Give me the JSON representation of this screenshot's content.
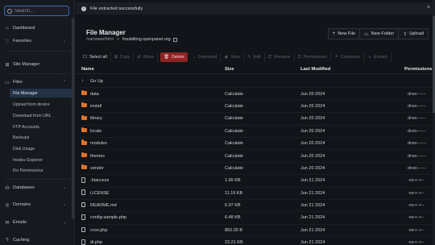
{
  "sidebar": {
    "search_placeholder": "Search...",
    "dashboard": "Dashboard",
    "favorites": "Favorites",
    "site_manager": "Site Manager",
    "files": "Files",
    "files_sub": [
      "File Manager",
      "Upload from device",
      "Download from URL",
      "FTP Accounts",
      "Backups",
      "Disk Usage",
      "Inodes Explorer",
      "Fix Permissions"
    ],
    "databases": "Databases",
    "domains": "Domains",
    "emails": "Emails",
    "caching": "Caching"
  },
  "toast": {
    "message": "File extracted successfully",
    "info_glyph": "i",
    "close_glyph": "×"
  },
  "page": {
    "title": "File Manager",
    "path_root": "/var/www/html",
    "path_sep": ">",
    "path_current": "fossbilling.openpanel.org"
  },
  "top_buttons": {
    "new_file": "New File",
    "new_folder": "New Folder",
    "upload": "Upload"
  },
  "toolbar": {
    "select_all": "Select all",
    "copy": "Copy",
    "move": "Move",
    "delete": "Delete",
    "download": "Download",
    "view": "View",
    "edit": "Edit",
    "rename": "Rename",
    "permissions": "Permissions",
    "compress": "Compress",
    "extract": "Extract"
  },
  "table": {
    "headers": {
      "name": "Name",
      "size": "Size",
      "modified": "Last Modified",
      "permissions": "Permissions"
    },
    "go_up": "Go Up",
    "rows": [
      {
        "type": "folder",
        "name": "data",
        "size": "Calculate",
        "modified": "Jun 20 2024",
        "perm": "drwx------"
      },
      {
        "type": "folder",
        "name": "install",
        "size": "Calculate",
        "modified": "Jun 20 2024",
        "perm": "drwx------"
      },
      {
        "type": "folder",
        "name": "library",
        "size": "Calculate",
        "modified": "Jun 20 2024",
        "perm": "drwx------"
      },
      {
        "type": "folder",
        "name": "locale",
        "size": "Calculate",
        "modified": "Jun 20 2024",
        "perm": "drwx------"
      },
      {
        "type": "folder",
        "name": "modules",
        "size": "Calculate",
        "modified": "Jun 20 2024",
        "perm": "drwx------"
      },
      {
        "type": "folder",
        "name": "themes",
        "size": "Calculate",
        "modified": "Jun 20 2024",
        "perm": "drwx------"
      },
      {
        "type": "folder",
        "name": "vendor",
        "size": "Calculate",
        "modified": "Jun 20 2024",
        "perm": "drwx------"
      },
      {
        "type": "file",
        "name": ".htaccess",
        "size": "1.65 KB",
        "modified": "Jun 21 2024",
        "perm": "-rw-r--r--"
      },
      {
        "type": "file",
        "name": "LICENSE",
        "size": "11.19 KB",
        "modified": "Jun 21 2024",
        "perm": "-rw-r--r--"
      },
      {
        "type": "file",
        "name": "README.md",
        "size": "5.97 KB",
        "modified": "Jun 21 2024",
        "perm": "-rw-r--r--"
      },
      {
        "type": "file",
        "name": "config-sample.php",
        "size": "6.48 KB",
        "modified": "Jun 21 2024",
        "perm": "-rw-r--r--"
      },
      {
        "type": "file",
        "name": "cron.php",
        "size": "850.00 B",
        "modified": "Jun 21 2024",
        "perm": "-rw-r--r--"
      },
      {
        "type": "file",
        "name": "di.php",
        "size": "23.21 KB",
        "modified": "Jun 21 2024",
        "perm": "-rw-r--r--"
      }
    ]
  },
  "colors": {
    "accent": "#3a6db5",
    "folder": "#e0732a",
    "delete": "#8e2424",
    "active_nav": "#243247"
  }
}
